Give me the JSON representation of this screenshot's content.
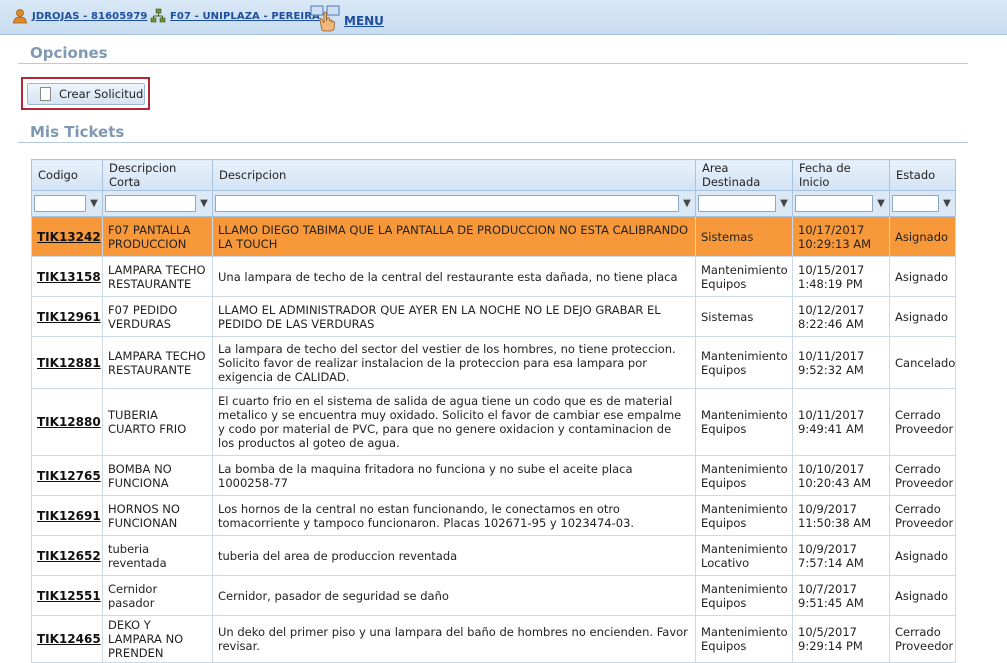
{
  "topbar": {
    "user_link": "JDROJAS - 81605979",
    "location_link": "F07 - UNIPLAZA - PEREIRA",
    "menu_label": "MENU",
    "user_icon": "user-icon",
    "location_icon": "network-icon",
    "menu_icon": "hand-pointer-menu-icon"
  },
  "opciones": {
    "title": "Opciones",
    "crear_label": "Crear Solicitud"
  },
  "tickets": {
    "title": "Mis Tickets",
    "columns": [
      "Codigo",
      "Descripcion Corta",
      "Descripcion",
      "Area Destinada",
      "Fecha de Inicio",
      "Estado"
    ],
    "rows": [
      {
        "codigo": "TIK13242",
        "corta": "F07 PANTALLA PRODUCCION",
        "descripcion": "LLAMO DIEGO TABIMA QUE LA PANTALLA DE PRODUCCION NO ESTA CALIBRANDO LA TOUCH",
        "area": "Sistemas",
        "fecha": "10/17/2017 10:29:13 AM",
        "estado": "Asignado"
      },
      {
        "codigo": "TIK13158",
        "corta": "LAMPARA TECHO RESTAURANTE",
        "descripcion": "Una lampara de techo de la central del restaurante esta dañada, no tiene placa",
        "area": "Mantenimiento Equipos",
        "fecha": "10/15/2017 1:48:19 PM",
        "estado": "Asignado"
      },
      {
        "codigo": "TIK12961",
        "corta": "F07 PEDIDO VERDURAS",
        "descripcion": "LLAMO EL ADMINISTRADOR QUE AYER EN LA NOCHE NO LE DEJO GRABAR EL PEDIDO DE LAS VERDURAS",
        "area": "Sistemas",
        "fecha": "10/12/2017 8:22:46 AM",
        "estado": "Asignado"
      },
      {
        "codigo": "TIK12881",
        "corta": "LAMPARA TECHO RESTAURANTE",
        "descripcion": "La lampara de techo del sector del vestier de los hombres, no tiene proteccion. Solicito favor de realizar instalacion de la proteccion para esa lampara por exigencia de CALIDAD.",
        "area": "Mantenimiento Equipos",
        "fecha": "10/11/2017 9:52:32 AM",
        "estado": "Cancelado"
      },
      {
        "codigo": "TIK12880",
        "corta": "TUBERIA CUARTO FRIO",
        "descripcion": "El cuarto frio en el sistema de salida de agua tiene un codo que es de material metalico y se encuentra muy oxidado. Solicito el favor de cambiar ese empalme y codo por material de PVC, para que no genere oxidacion y contaminacion de los productos al goteo de agua.",
        "area": "Mantenimiento Equipos",
        "fecha": "10/11/2017 9:49:41 AM",
        "estado": "Cerrado Proveedor"
      },
      {
        "codigo": "TIK12765",
        "corta": "BOMBA NO FUNCIONA",
        "descripcion": "La bomba de la maquina fritadora no funciona y no sube el aceite placa 1000258-77",
        "area": "Mantenimiento Equipos",
        "fecha": "10/10/2017 10:20:43 AM",
        "estado": "Cerrado Proveedor"
      },
      {
        "codigo": "TIK12691",
        "corta": "HORNOS NO FUNCIONAN",
        "descripcion": "Los hornos de la central no estan funcionando, le conectamos en otro tomacorriente y tampoco funcionaron. Placas 102671-95 y 1023474-03.",
        "area": "Mantenimiento Equipos",
        "fecha": "10/9/2017 11:50:38 AM",
        "estado": "Cerrado Proveedor"
      },
      {
        "codigo": "TIK12652",
        "corta": "tuberia reventada",
        "descripcion": "tuberia del area de produccion reventada",
        "area": "Mantenimiento Locativo",
        "fecha": "10/9/2017 7:57:14 AM",
        "estado": "Asignado"
      },
      {
        "codigo": "TIK12551",
        "corta": "Cernidor pasador",
        "descripcion": "Cernidor, pasador de seguridad se daño",
        "area": "Mantenimiento Equipos",
        "fecha": "10/7/2017 9:51:45 AM",
        "estado": "Asignado"
      },
      {
        "codigo": "TIK12465",
        "corta": "DEKO Y LAMPARA NO PRENDEN",
        "descripcion": "Un deko del primer piso y una lampara del baño de hombres no encienden. Favor revisar.",
        "area": "Mantenimiento Equipos",
        "fecha": "10/5/2017 9:29:14 PM",
        "estado": "Cerrado Proveedor"
      }
    ]
  },
  "colors": {
    "selected_row": "#f7983a",
    "link": "#1d4fa0",
    "section_title": "#7f98b4",
    "highlight_border": "#b1283d"
  }
}
